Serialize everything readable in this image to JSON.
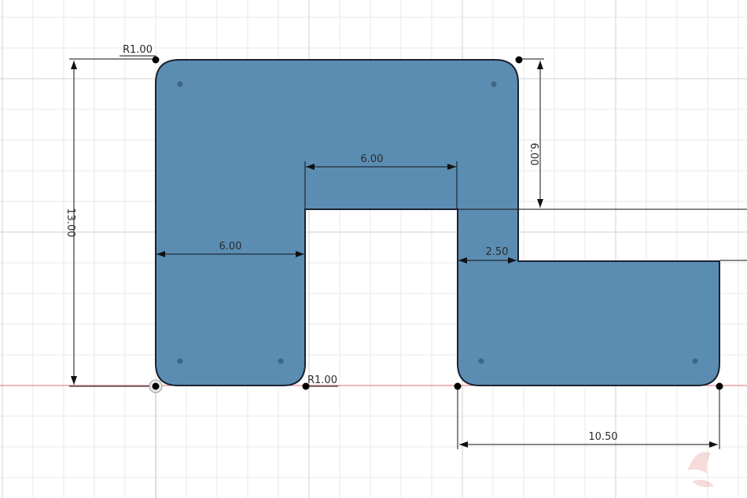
{
  "colors": {
    "background": "#ffffff",
    "grid_minor": "#e9e9e9",
    "grid_major": "#d2d2d2",
    "x_axis": "#e07070",
    "y_axis": "#9fcf9f",
    "profile_fill": "#5b8db3",
    "profile_edge": "#1a2230",
    "dimension": "#111111"
  },
  "sketch": {
    "dimensions": {
      "overall_height": "13.00",
      "top_right_height": "6.00",
      "slot_width": "6.00",
      "left_leg_width": "6.00",
      "step_offset": "2.50",
      "right_foot_width": "10.50"
    },
    "radius_labels": {
      "top_left": "R1.00",
      "bottom_inner": "R1.00"
    }
  }
}
